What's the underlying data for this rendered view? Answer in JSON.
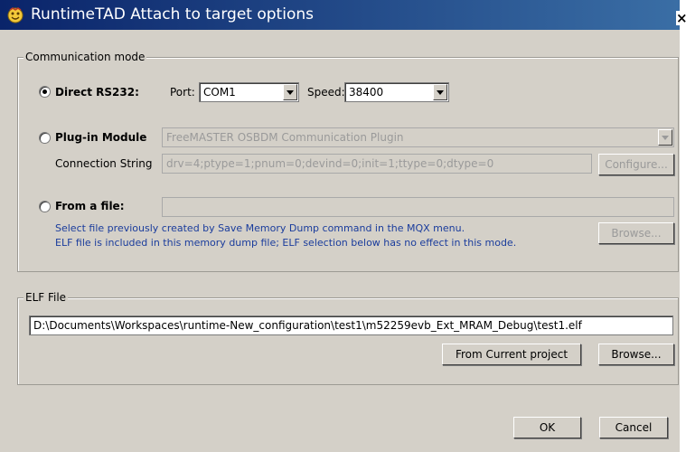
{
  "window": {
    "title": "RuntimeTAD Attach to target options",
    "close_label": "×"
  },
  "comm": {
    "legend": "Communication mode",
    "direct": {
      "label": "Direct RS232:",
      "selected": true,
      "port_label": "Port:",
      "port_value": "COM1",
      "speed_label": "Speed:",
      "speed_value": "38400"
    },
    "plugin": {
      "label": "Plug-in Module",
      "selected": false,
      "module_value": "FreeMASTER OSBDM Communication Plugin",
      "connection_label": "Connection String",
      "connection_value": "drv=4;ptype=1;pnum=0;devind=0;init=1;ttype=0;dtype=0",
      "configure_label": "Configure..."
    },
    "file": {
      "label": "From a file:",
      "selected": false,
      "path_value": "",
      "info_line1": "Select file previously created by Save Memory Dump command in the MQX menu.",
      "info_line2": "ELF file is included in this memory dump file; ELF selection below has no effect in this mode.",
      "browse_label": "Browse..."
    }
  },
  "elf": {
    "legend": "ELF File",
    "path_value": "D:\\Documents\\Workspaces\\runtime-New_configuration\\test1\\m52259evb_Ext_MRAM_Debug\\test1.elf",
    "from_project_label": "From Current project",
    "browse_label": "Browse..."
  },
  "footer": {
    "ok_label": "OK",
    "cancel_label": "Cancel"
  },
  "colors": {
    "title_bar": "#0a246a",
    "dialog_bg": "#d4d0c8",
    "info_text": "#1a3c9c"
  }
}
